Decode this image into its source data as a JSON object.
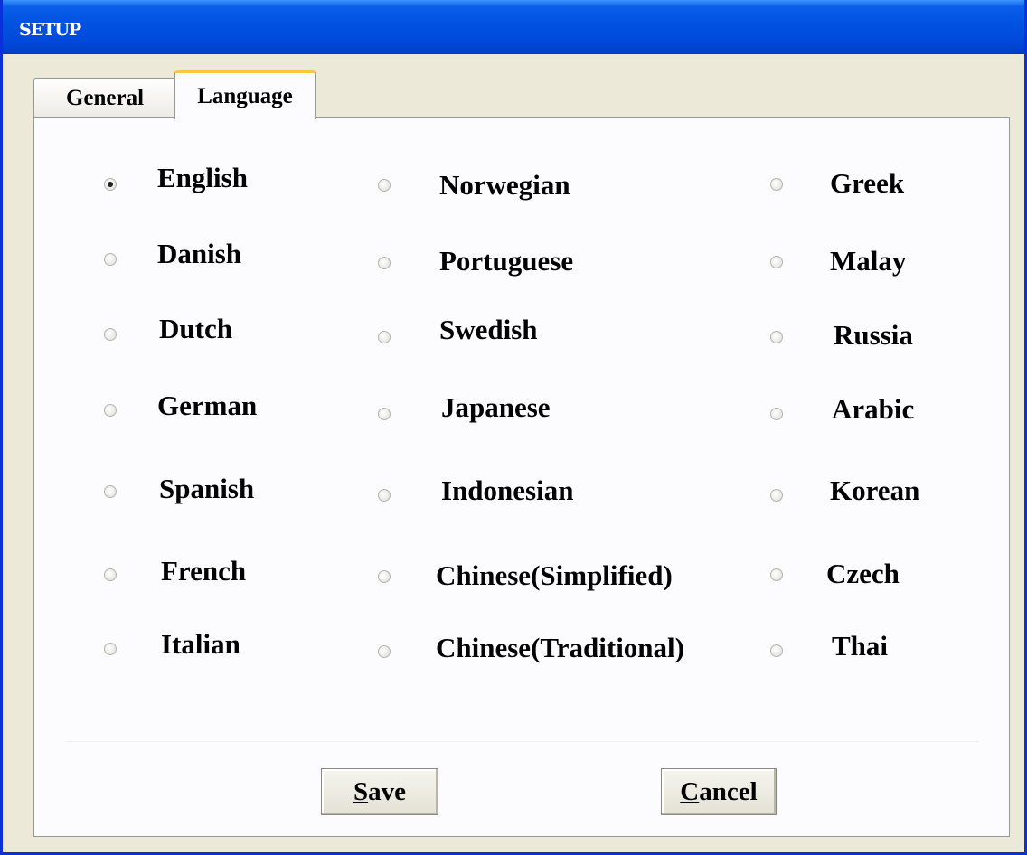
{
  "window": {
    "title": "SETUP"
  },
  "tabs": [
    {
      "label": "General",
      "active": false
    },
    {
      "label": "Language",
      "active": true
    }
  ],
  "languages": {
    "col1": [
      "English",
      "Danish",
      "Dutch",
      "German",
      "Spanish",
      "French",
      "Italian"
    ],
    "col2": [
      "Norwegian",
      "Portuguese",
      "Swedish",
      "Japanese",
      "Indonesian",
      "Chinese(Simplified)",
      "Chinese(Traditional)"
    ],
    "col3": [
      "Greek",
      "Malay",
      "Russia",
      "Arabic",
      "Korean",
      "Czech",
      "Thai"
    ],
    "selected": "English"
  },
  "buttons": {
    "save": {
      "mnemonic": "S",
      "rest": "ave"
    },
    "cancel": {
      "mnemonic": "C",
      "rest": "ancel"
    }
  },
  "colors": {
    "titlebar": "#0253e3",
    "accent_tab": "#ffc83c",
    "background": "#ece9d8"
  }
}
